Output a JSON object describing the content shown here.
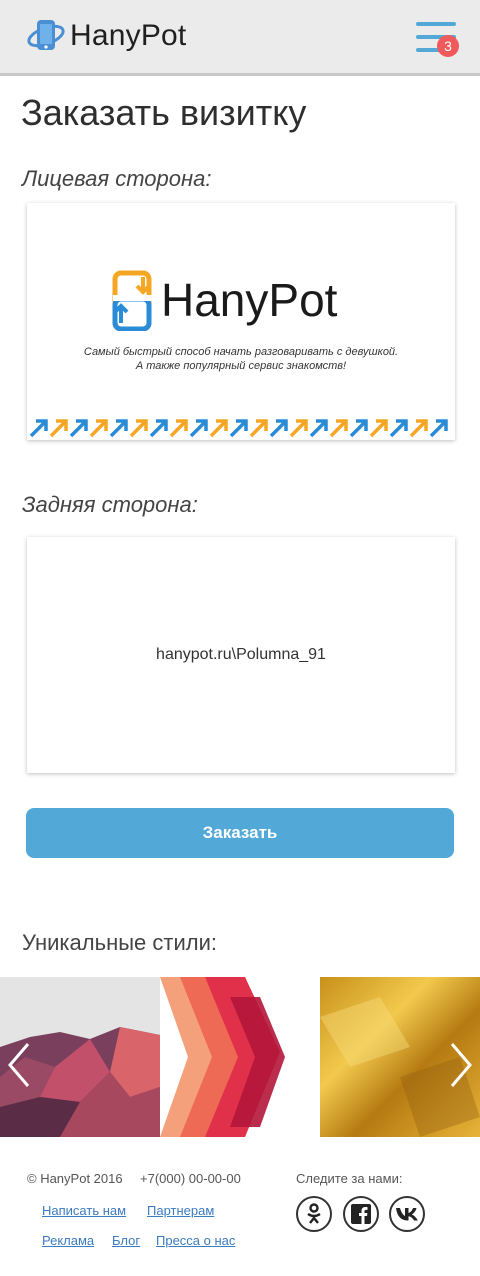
{
  "header": {
    "brand": "HanyPot",
    "menu_icon": "hamburger-menu-icon",
    "notification_count": "3",
    "accent": "#52a9d8",
    "badge_color": "#f05a5a"
  },
  "main": {
    "title": "Заказать визитку",
    "front_label": "Лицевая сторона:",
    "back_label": "Задняя сторона:",
    "front_card": {
      "brand": "HanyPot",
      "tagline_line1": "Самый быстрый способ начать разговаривать с девушкой.",
      "tagline_line2": "А также популярный сервис знакомств!",
      "arrow_colors": [
        "#2a8bd6",
        "#f5a623"
      ]
    },
    "back_card": {
      "text": "hanypot.ru\\Polumna_91"
    },
    "order_button": "Заказать",
    "styles_label": "Уникальные стили:"
  },
  "gallery": {
    "prev_icon": "chevron-left-icon",
    "next_icon": "chevron-right-icon",
    "slides": [
      "geometric-pattern",
      "red-chevron-pattern",
      "gold-foil-texture"
    ]
  },
  "footer": {
    "copyright": "© HanyPot 2016",
    "phone": "+7(000) 00-00-00",
    "links": [
      "Написать нам",
      "Партнерам",
      "Реклама",
      "Блог",
      "Пресса о нас"
    ],
    "follow_label": "Следите за нами:",
    "social": [
      "odnoklassniki-icon",
      "facebook-icon",
      "vk-icon"
    ]
  }
}
